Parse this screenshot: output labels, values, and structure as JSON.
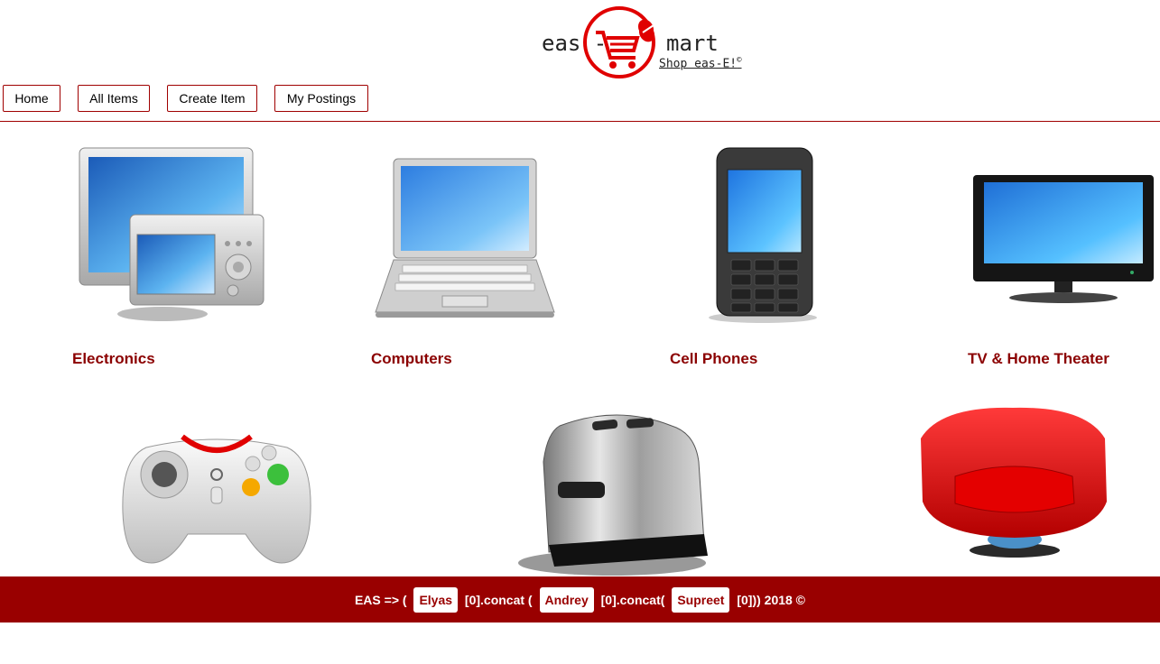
{
  "logo": {
    "left": "eas -",
    "right": "mart",
    "tagline": "Shop eas-E!",
    "mark": "©"
  },
  "nav": {
    "home": "Home",
    "all_items": "All Items",
    "create_item": "Create Item",
    "my_postings": "My Postings"
  },
  "categories": [
    {
      "label": "Electronics",
      "icon": "monitor-camera-icon"
    },
    {
      "label": "Computers",
      "icon": "laptop-icon"
    },
    {
      "label": "Cell Phones",
      "icon": "cell-phone-icon"
    },
    {
      "label": "TV & Home Theater",
      "icon": "tv-icon"
    }
  ],
  "second_row": [
    {
      "icon": "gamepad-icon"
    },
    {
      "icon": "toaster-icon"
    },
    {
      "icon": "armchair-icon"
    }
  ],
  "footer": {
    "prefix": "EAS => ( ",
    "name1": "Elyas",
    "mid1": " [0].concat ( ",
    "name2": "Andrey",
    "mid2": " [0].concat( ",
    "name3": "Supreet",
    "suffix": " [0])) 2018 ©"
  },
  "colors": {
    "brand": "#990000",
    "accent": "#e00000"
  }
}
